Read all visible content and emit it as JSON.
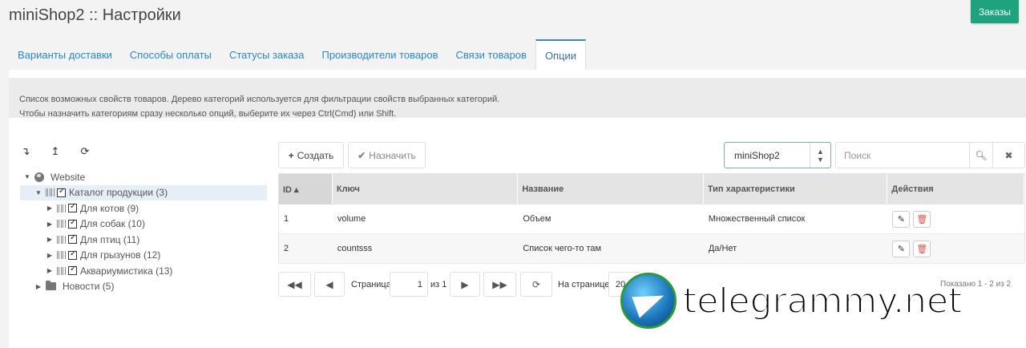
{
  "title": "miniShop2 :: Настройки",
  "orders_button": "Заказы",
  "tabs": [
    {
      "label": "Варианты доставки"
    },
    {
      "label": "Способы оплаты"
    },
    {
      "label": "Статусы заказа"
    },
    {
      "label": "Производители товаров"
    },
    {
      "label": "Связи товаров"
    },
    {
      "label": "Опции"
    }
  ],
  "description": {
    "line1": "Список возможных свойств товаров. Дерево категорий используется для фильтрации свойств выбранных категорий.",
    "line2": "Чтобы назначить категориям сразу несколько опций, выберите их через Ctrl(Cmd) или Shift."
  },
  "tree_toolbar": {
    "expand_icon": "↴",
    "collapse_icon": "↥",
    "refresh_icon": "⟳"
  },
  "tree": {
    "root": "Website",
    "catalog": "Каталог продукции (3)",
    "children": [
      {
        "label": "Для котов (9)"
      },
      {
        "label": "Для собак (10)"
      },
      {
        "label": "Для птиц (11)"
      },
      {
        "label": "Для грызунов (12)"
      },
      {
        "label": "Аквариумистика (13)"
      }
    ],
    "news": "Новости (5)"
  },
  "toolbar": {
    "create_label": "Создать",
    "assign_label": "Назначить",
    "select_value": "miniShop2",
    "search_placeholder": "Поиск"
  },
  "grid": {
    "columns": [
      "ID ▴",
      "Ключ",
      "Название",
      "Тип характеристики",
      "Действия"
    ],
    "rows": [
      {
        "id": "1",
        "key": "volume",
        "name": "Объем",
        "type": "Множественный список"
      },
      {
        "id": "2",
        "key": "countsss",
        "name": "Список чего-то там",
        "type": "Да/Нет"
      }
    ]
  },
  "pager": {
    "page_label": "Страница",
    "page_value": "1",
    "of_label": "из 1",
    "per_page_label": "На странице:",
    "per_page_value": "20",
    "shown": "Показано 1 - 2 из 2"
  },
  "watermark": "telegrammy.net"
}
